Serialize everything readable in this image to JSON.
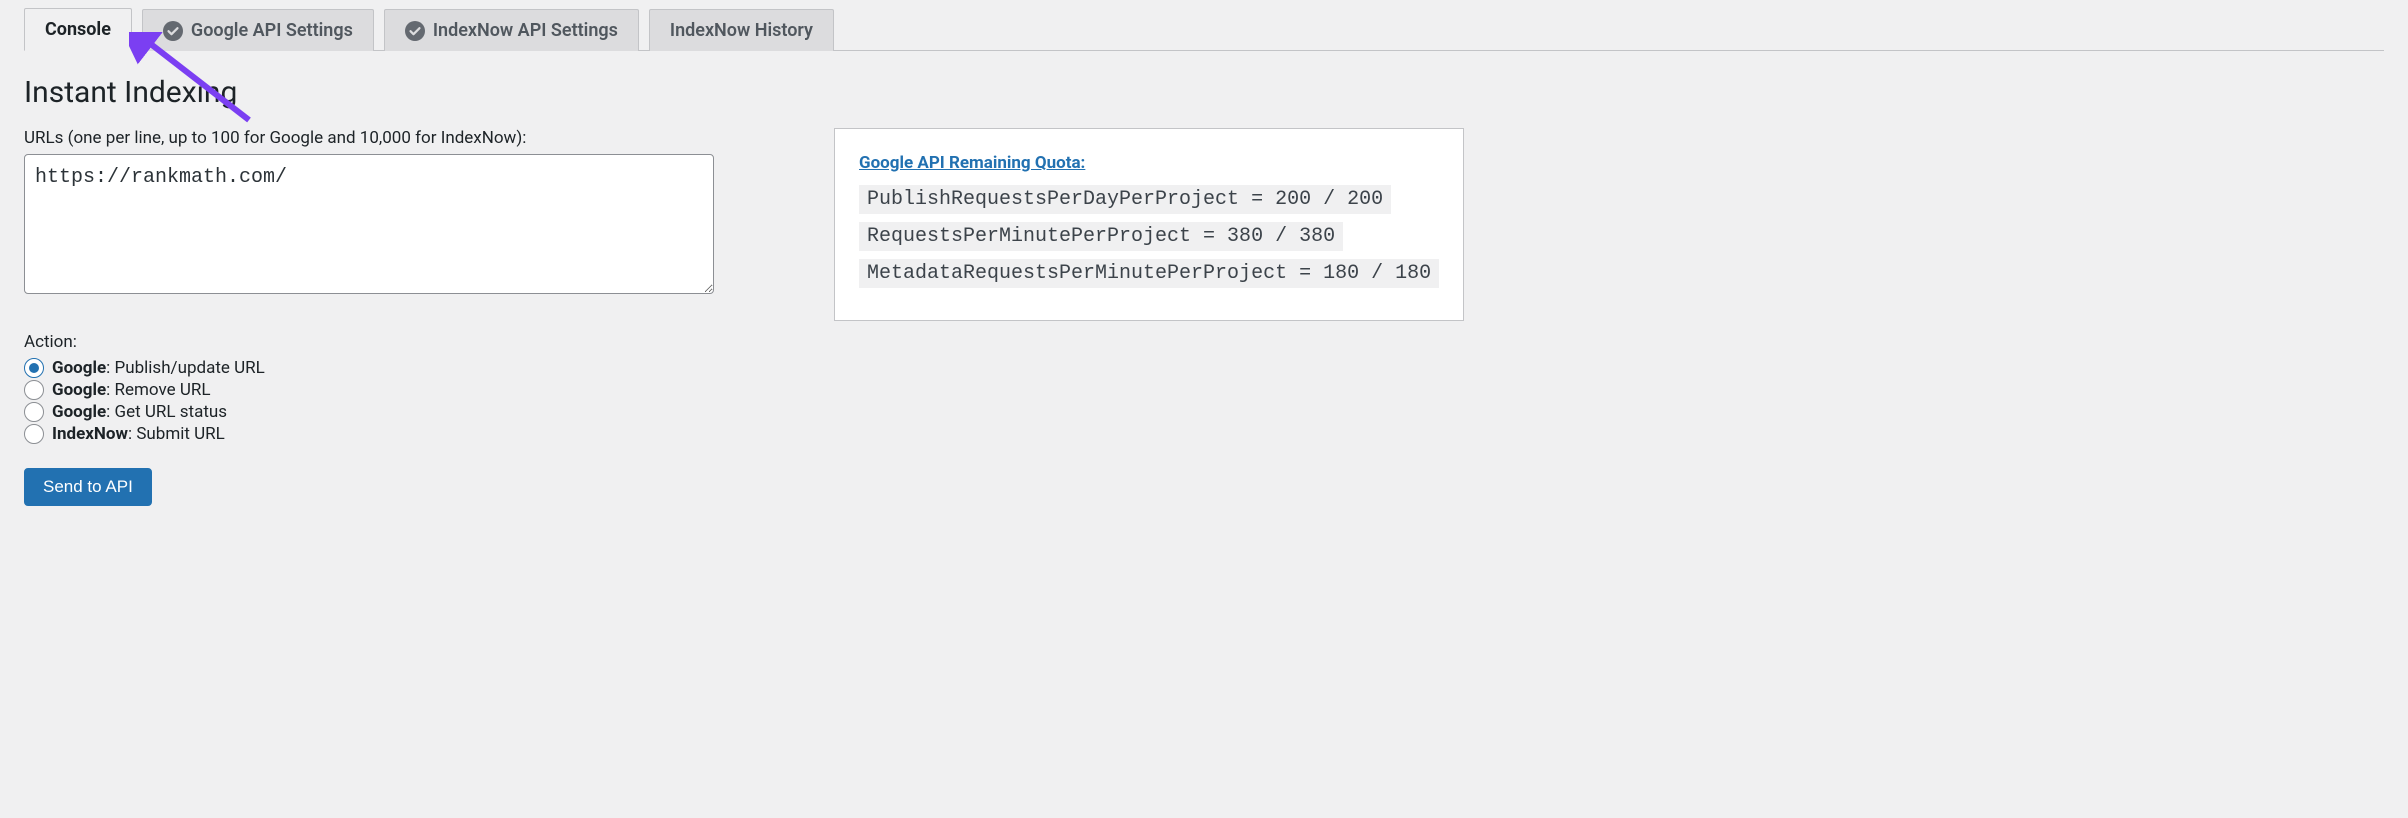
{
  "tabs": {
    "console": "Console",
    "google_api": "Google API Settings",
    "indexnow_api": "IndexNow API Settings",
    "indexnow_history": "IndexNow History"
  },
  "page_title": "Instant Indexing",
  "urls_field": {
    "label": "URLs (one per line, up to 100 for Google and 10,000 for IndexNow):",
    "value": "https://rankmath.com/"
  },
  "quota": {
    "link_label": "Google API Remaining Quota:",
    "rows": [
      "PublishRequestsPerDayPerProject = 200 / 200",
      "RequestsPerMinutePerProject = 380 / 380",
      "MetadataRequestsPerMinutePerProject = 180 / 180"
    ]
  },
  "action": {
    "label": "Action:",
    "options": {
      "google_publish": {
        "prefix": "Google",
        "suffix": ": Publish/update URL"
      },
      "google_remove": {
        "prefix": "Google",
        "suffix": ": Remove URL"
      },
      "google_status": {
        "prefix": "Google",
        "suffix": ": Get URL status"
      },
      "indexnow_submit": {
        "prefix": "IndexNow",
        "suffix": ": Submit URL"
      }
    },
    "selected": "google_publish"
  },
  "submit_label": "Send to API"
}
